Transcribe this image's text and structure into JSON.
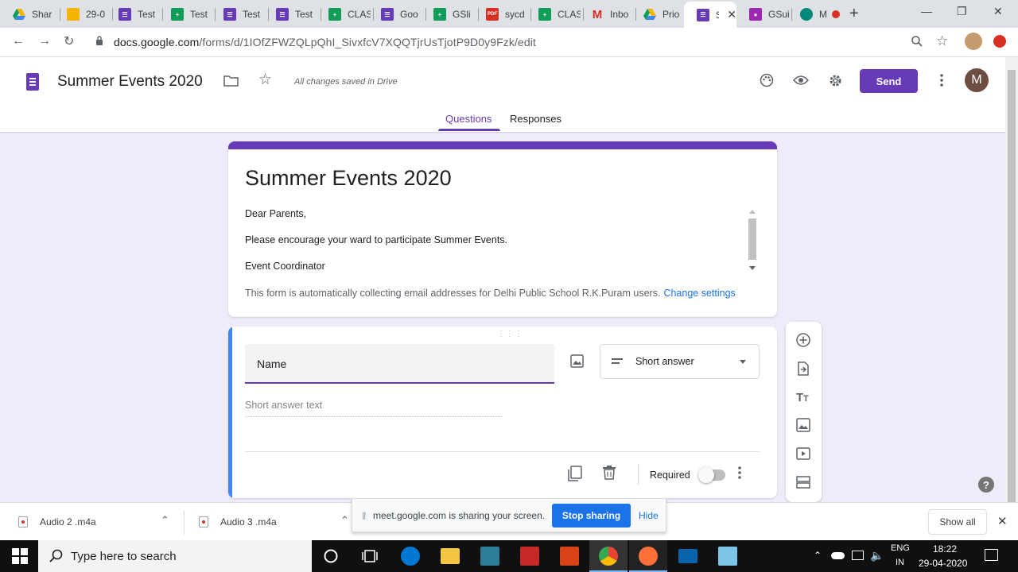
{
  "browser": {
    "tabs": [
      {
        "label": "Shar",
        "icon": "google-drive-icon",
        "color": "#1a73e8"
      },
      {
        "label": "29-0",
        "icon": "google-slides-icon",
        "color": "#f4b400"
      },
      {
        "label": "Test",
        "icon": "google-forms-icon",
        "color": "#673ab7"
      },
      {
        "label": "Test",
        "icon": "google-sheets-icon",
        "color": "#0f9d58"
      },
      {
        "label": "Test",
        "icon": "google-forms-icon",
        "color": "#673ab7"
      },
      {
        "label": "Test",
        "icon": "google-forms-icon",
        "color": "#673ab7"
      },
      {
        "label": "CLAS",
        "icon": "google-sheets-icon",
        "color": "#0f9d58"
      },
      {
        "label": "Goo",
        "icon": "google-forms-icon",
        "color": "#673ab7"
      },
      {
        "label": "GSli",
        "icon": "google-sheets-icon",
        "color": "#0f9d58"
      },
      {
        "label": "sycd",
        "icon": "pdf-icon",
        "color": "#d93025"
      },
      {
        "label": "CLAS",
        "icon": "google-sheets-icon",
        "color": "#0f9d58"
      },
      {
        "label": "Inbo",
        "icon": "gmail-icon",
        "color": "#d93025"
      },
      {
        "label": "Prio",
        "icon": "google-drive-icon",
        "color": "#1a73e8"
      },
      {
        "label": "S",
        "icon": "google-forms-icon",
        "color": "#673ab7",
        "active": true
      },
      {
        "label": "GSui",
        "icon": "google-classroom-icon",
        "color": "#9c27b0"
      },
      {
        "label": "M",
        "icon": "google-meet-icon",
        "color": "#00897b"
      }
    ],
    "new_tab_label": "+",
    "url_host": "docs.google.com",
    "url_path": "/forms/d/1IOfZFWZQLpQhI_SivxfcV7XQQTjrUsTjotP9D0y9Fzk/edit"
  },
  "forms_header": {
    "doc_title": "Summer Events 2020",
    "save_status": "All changes saved in Drive",
    "send_label": "Send",
    "avatar_initial": "M",
    "tabs": [
      "Questions",
      "Responses"
    ],
    "active_tab": "Questions",
    "accent_color": "#673ab7"
  },
  "form": {
    "title": "Summer Events 2020",
    "description": [
      "Dear Parents,",
      "Please encourage your ward to participate Summer Events.",
      "Event Coordinator"
    ],
    "email_notice": "This form is automatically collecting email addresses for Delhi Public School R.K.Puram users.",
    "change_settings_label": "Change settings"
  },
  "question": {
    "title": "Name",
    "type": "Short answer",
    "answer_placeholder": "Short answer text",
    "required_label": "Required",
    "required": false
  },
  "side_toolbar": [
    "add-question-icon",
    "import-questions-icon",
    "add-title-icon",
    "add-image-icon",
    "add-video-icon",
    "add-section-icon"
  ],
  "downloads": [
    {
      "name": "Audio 2 .m4a"
    },
    {
      "name": "Audio 3 .m4a"
    }
  ],
  "show_all_label": "Show all",
  "screen_share": {
    "message": "meet.google.com is sharing your screen.",
    "stop_label": "Stop sharing",
    "hide_label": "Hide"
  },
  "taskbar": {
    "search_placeholder": "Type here to search",
    "language": "ENG",
    "region": "IN",
    "time": "18:22",
    "date": "29-04-2020"
  }
}
